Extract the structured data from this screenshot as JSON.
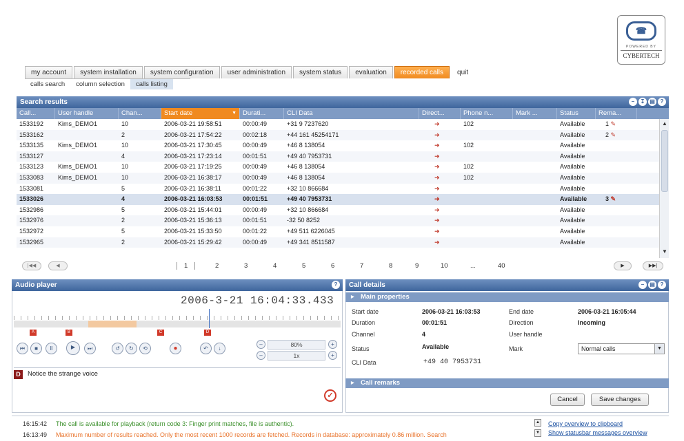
{
  "logo": {
    "line1": "POWERED BY",
    "brand": "CYBERTECH"
  },
  "tabs": [
    "my account",
    "system installation",
    "system configuration",
    "user administration",
    "system status",
    "evaluation",
    "recorded calls",
    "quit"
  ],
  "subtabs": [
    "calls search",
    "column selection",
    "calls listing"
  ],
  "search_results": {
    "title": "Search results",
    "columns": [
      "Call...",
      "User handle",
      "Chan...",
      "Start date",
      "Durati...",
      "CLI Data",
      "Direct...",
      "Phone n...",
      "Mark ...",
      "Status",
      "Rema..."
    ],
    "rows": [
      [
        "1533192",
        "Kims_DEMO1",
        "10",
        "2006-03-21 19:58:51",
        "00:00:49",
        "+31 9 7237620",
        "102",
        "Available",
        "1"
      ],
      [
        "1533162",
        "",
        "2",
        "2006-03-21 17:54:22",
        "00:02:18",
        "+44 161 45254171",
        "",
        "Available",
        "2"
      ],
      [
        "1533135",
        "Kims_DEMO1",
        "10",
        "2006-03-21 17:30:45",
        "00:00:49",
        "+46 8 138054",
        "102",
        "Available",
        ""
      ],
      [
        "1533127",
        "",
        "4",
        "2006-03-21 17:23:14",
        "00:01:51",
        "+49 40 7953731",
        "",
        "Available",
        ""
      ],
      [
        "1533123",
        "Kims_DEMO1",
        "10",
        "2006-03-21 17:19:25",
        "00:00:49",
        "+46 8 138054",
        "102",
        "Available",
        ""
      ],
      [
        "1533083",
        "Kims_DEMO1",
        "10",
        "2006-03-21 16:38:17",
        "00:00:49",
        "+46 8 138054",
        "102",
        "Available",
        ""
      ],
      [
        "1533081",
        "",
        "5",
        "2006-03-21 16:38:11",
        "00:01:22",
        "+32 10 866684",
        "",
        "Available",
        ""
      ],
      [
        "1533026",
        "",
        "4",
        "2006-03-21 16:03:53",
        "00:01:51",
        "+49 40 7953731",
        "",
        "Available",
        "3"
      ],
      [
        "1532986",
        "",
        "5",
        "2006-03-21 15:44:01",
        "00:00:49",
        "+32 10 866684",
        "",
        "Available",
        ""
      ],
      [
        "1532976",
        "",
        "2",
        "2006-03-21 15:36:13",
        "00:01:51",
        "-32 50 8252",
        "",
        "Available",
        ""
      ],
      [
        "1532972",
        "",
        "5",
        "2006-03-21 15:33:50",
        "00:01:22",
        "+49 511 6226045",
        "",
        "Available",
        ""
      ],
      [
        "1532965",
        "",
        "2",
        "2006-03-21 15:29:42",
        "00:00:49",
        "+49 341 8511587",
        "",
        "Available",
        ""
      ]
    ],
    "pages": [
      "1",
      "2",
      "3",
      "4",
      "5",
      "6",
      "7",
      "8",
      "9",
      "10",
      "...",
      "40"
    ]
  },
  "audio_player": {
    "title": "Audio player",
    "timestamp": "2006-3-21 16:04:33.433",
    "markers": [
      "A",
      "B",
      "C",
      "D"
    ],
    "volume": "80%",
    "speed": "1x",
    "note_marker": "D",
    "note_text": "Notice the strange voice"
  },
  "call_details": {
    "title": "Call details",
    "main_properties": "Main properties",
    "fields": {
      "start_date_label": "Start date",
      "start_date": "2006-03-21 16:03:53",
      "end_date_label": "End date",
      "end_date": "2006-03-21 16:05:44",
      "duration_label": "Duration",
      "duration": "00:01:51",
      "direction_label": "Direction",
      "direction": "Incoming",
      "channel_label": "Channel",
      "channel": "4",
      "user_handle_label": "User handle",
      "status_label": "Status",
      "status": "Available",
      "mark_label": "Mark",
      "mark": "Normal calls",
      "cli_label": "CLI Data",
      "cli": "+49 40 7953731"
    },
    "call_remarks": "Call remarks",
    "cancel": "Cancel",
    "save": "Save changes"
  },
  "statusbar": {
    "line1_time": "16:15:42",
    "line1_text": "The call is available for playback (return code 3: Finger print matches, file is authentic).",
    "line2_time": "16:13:49",
    "line2_text": "Maximum number of results reached. Only the most recent 1000 records are fetched. Records in database: approximately 0.86 million. Search",
    "link1": "Copy overview to clipboard",
    "link2": "Show statusbar messages overview"
  }
}
